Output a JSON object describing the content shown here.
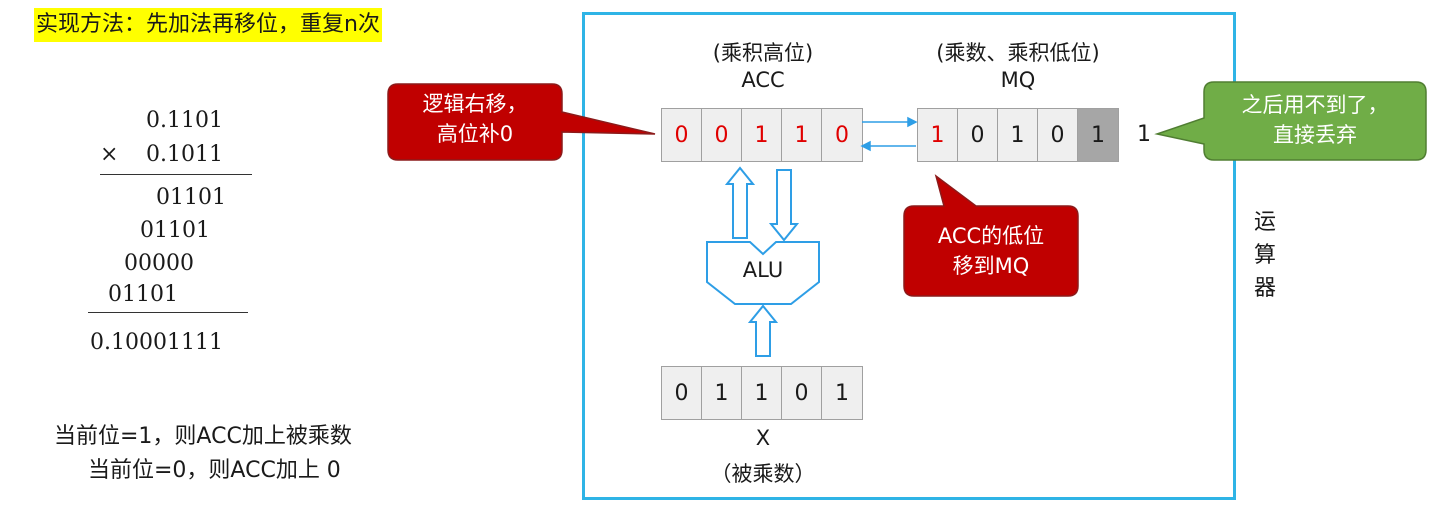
{
  "title": "实现方法：先加法再移位，重复n次",
  "calc": {
    "multiplicand": "0.1101",
    "times_sign": "×",
    "multiplier": "0.1011",
    "partials": [
      "01101",
      "01101",
      "00000",
      "01101"
    ],
    "result": "0.10001111"
  },
  "rule_notes": {
    "line1": "当前位=1，则ACC加上被乘数",
    "line2": "当前位=0，则ACC加上 0"
  },
  "unit_label": [
    "运",
    "算",
    "器"
  ],
  "acc": {
    "caption": "(乘积高位)",
    "name": "ACC",
    "bits": [
      "0",
      "0",
      "1",
      "1",
      "0"
    ]
  },
  "mq": {
    "caption": "(乘数、乘积低位)",
    "name": "MQ",
    "bits": [
      "1",
      "0",
      "1",
      "0",
      "1"
    ],
    "dropped": "1"
  },
  "alu": {
    "label": "ALU"
  },
  "x_reg": {
    "bits": [
      "0",
      "1",
      "1",
      "0",
      "1"
    ],
    "name": "X",
    "caption": "（被乘数）"
  },
  "callouts": {
    "shift_right": [
      "逻辑右移，",
      "高位补0"
    ],
    "acc_to_mq": [
      "ACC的低位",
      "移到MQ"
    ],
    "discard": [
      "之后用不到了，",
      "直接丢弃"
    ]
  },
  "colors": {
    "title_highlight": "#ffff00",
    "frame_border": "#2eb4e6",
    "callout_red": "#c00000",
    "callout_green": "#70ad47",
    "bit_red": "#e00000",
    "dropped_cell": "#a6a6a6",
    "arrow_blue": "#2e9ee6"
  }
}
